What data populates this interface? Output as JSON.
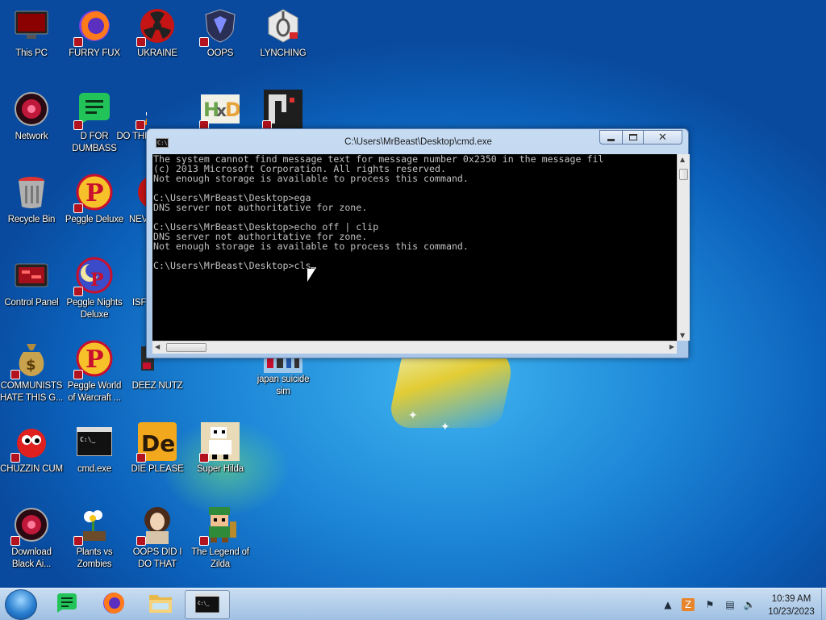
{
  "desktop_icons": [
    {
      "label": "This PC",
      "icon": "monitor-icon"
    },
    {
      "label": "FURRY FUX",
      "icon": "firefox-icon"
    },
    {
      "label": "UKRAINE",
      "icon": "radiation-icon"
    },
    {
      "label": "OOPS",
      "icon": "shield-icon"
    },
    {
      "label": "LYNCHING",
      "icon": "noose-icon"
    },
    {
      "label": "Network",
      "icon": "globe-icon"
    },
    {
      "label": "D FOR DUMBASS",
      "icon": "chat-icon"
    },
    {
      "label": "DO THI",
      "icon": "vlc-cone-icon"
    },
    {
      "label": "",
      "icon": "hxd-icon"
    },
    {
      "label": "",
      "icon": "pixel-app-icon"
    },
    {
      "label": "Recycle Bin",
      "icon": "recycle-bin-icon"
    },
    {
      "label": "Peggle Deluxe",
      "icon": "peggle-icon"
    },
    {
      "label": "NEV",
      "icon": "radiation-icon"
    },
    {
      "label": "Control Panel",
      "icon": "control-panel-icon"
    },
    {
      "label": "Peggle Nights Deluxe",
      "icon": "peggle-nights-icon"
    },
    {
      "label": "ISF",
      "icon": "app-icon"
    },
    {
      "label": "COMMUNISTS HATE THIS G...",
      "icon": "money-bag-icon"
    },
    {
      "label": "Peggle World of Warcraft ...",
      "icon": "peggle-icon"
    },
    {
      "label": "DEEZ NUTZ",
      "icon": "app-icon"
    },
    {
      "label": "japan suicide sim",
      "icon": "game-icon"
    },
    {
      "label": "CHUZZIN CUM",
      "icon": "chuzzle-icon"
    },
    {
      "label": "cmd.exe",
      "icon": "terminal-icon"
    },
    {
      "label": "DIE PLEASE",
      "icon": "de-icon"
    },
    {
      "label": "Super Hilda",
      "icon": "pixel-character-icon"
    },
    {
      "label": "Download Black Ai...",
      "icon": "globe-icon"
    },
    {
      "label": "Plants vs Zombies",
      "icon": "flower-icon"
    },
    {
      "label": "OOPS DID I DO THAT",
      "icon": "portrait-icon"
    },
    {
      "label": "The Legend of Zilda",
      "icon": "pixel-hero-icon"
    }
  ],
  "cmd_window": {
    "title": "C:\\Users\\MrBeast\\Desktop\\cmd.exe",
    "lines": [
      "The system cannot find message text for message number 0x2350 in the message fil",
      "(c) 2013 Microsoft Corporation. All rights reserved.",
      "Not enough storage is available to process this command.",
      "",
      "C:\\Users\\MrBeast\\Desktop>ega",
      "DNS server not authoritative for zone.",
      "",
      "C:\\Users\\MrBeast\\Desktop>echo off | clip",
      "DNS server not authoritative for zone.",
      "Not enough storage is available to process this command.",
      "",
      "C:\\Users\\MrBeast\\Desktop>cls"
    ],
    "minimize_icon": "minimize-icon",
    "maximize_icon": "maximize-icon",
    "close_icon": "close-icon"
  },
  "taskbar": {
    "pinned": [
      {
        "name": "chat-app",
        "icon": "chat-icon"
      },
      {
        "name": "firefox",
        "icon": "firefox-icon"
      },
      {
        "name": "file-explorer",
        "icon": "folder-icon"
      },
      {
        "name": "cmd",
        "icon": "terminal-icon",
        "active": true
      }
    ],
    "tray_icons": [
      "chevron-up-icon",
      "app-tray-icon",
      "flag-icon",
      "network-icon",
      "volume-icon"
    ],
    "clock_time": "10:39 AM",
    "clock_date": "10/23/2023"
  },
  "colors": {
    "console_bg": "#000000",
    "console_fg": "#c0c0c0",
    "taskbar": "#b9d3ee",
    "wallpaper": "#1e88d8"
  }
}
